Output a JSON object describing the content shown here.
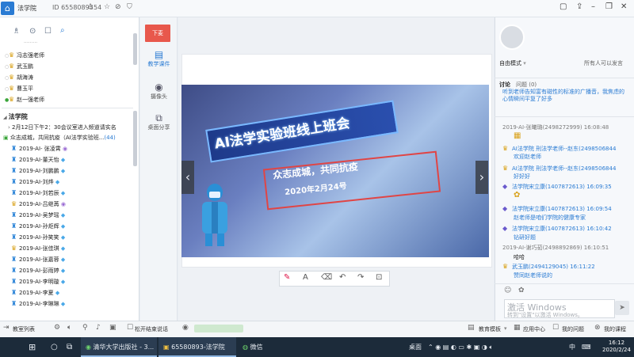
{
  "titlebar": {
    "app_name": "法学院",
    "room_id": "ID 65580893",
    "online_count": "54",
    "icons": [
      "home-icon",
      "user-count-icon",
      "bookmark-icon",
      "no-audio-icon",
      "shield-icon"
    ]
  },
  "left_panel": {
    "tool_icons": [
      "member-list-icon",
      "location-icon",
      "note-icon",
      "search-icon"
    ],
    "top_members": [
      {
        "name": "冯志强老师",
        "hat": "gold"
      },
      {
        "name": "武玉鹏",
        "hat": "gold"
      },
      {
        "name": "胡海涛",
        "hat": "gold"
      },
      {
        "name": "曹玉平",
        "hat": "gold"
      },
      {
        "name": "赵一强老师",
        "hat": "gold",
        "online": true
      }
    ],
    "section_title": "法学院",
    "notice": "2月12日下午2：30会议室进入频道请实名",
    "group_name": "众志成城，共同抗疫（AI法学实验班...",
    "group_count": "(44)",
    "members": [
      "2019-AI- 张凌霄",
      "2019-AI-董天怡",
      "2019-AI-刘鹏鹏",
      "2019-AI-刘烨",
      "2019-AI-刘若辰",
      "2019-AI-吕继苒",
      "2019-AI-吴梦瑶",
      "2019-AI-孙炬辉",
      "2019-AI-孙笑笑",
      "2019-AI-张佳琪",
      "2019-AI-张嘉蓉",
      "2019-AI-彭雨婷",
      "2019-AI-李明璇",
      "2019-AI-李夏",
      "2019-AI-李琳琳"
    ]
  },
  "mid_toolbar": {
    "raise_hand": "下麦",
    "items": [
      {
        "label": "教学课件",
        "icon": "courseware-icon",
        "active": true
      },
      {
        "label": "摄像头",
        "icon": "camera-icon",
        "active": false
      },
      {
        "label": "桌面分享",
        "icon": "screen-share-icon",
        "active": false
      }
    ]
  },
  "slide": {
    "title": "AI法学实验班线上班会",
    "motto": "众志成城，共同抗疫",
    "date": "2020年2月24号"
  },
  "draw_tools": [
    "pen-icon",
    "text-icon",
    "eraser-icon",
    "undo-icon",
    "redo-icon",
    "lock-icon"
  ],
  "right_panel": {
    "mode": "自由模式",
    "speak_perm": "所有人可以发言",
    "tabs": [
      "讨论",
      "问题 (0)"
    ],
    "question_text": "听到老师告知富有磁性的标准的广播音，我焦虑的心情瞬间平复了好多",
    "messages": [
      {
        "name": "2019-AI-张曦璐(2498272999) 16:08:48",
        "text": "",
        "style": "grey",
        "icon": "bread-icon"
      },
      {
        "name": "AI法学院 刑法学老师--赵东(2498506844",
        "text": "欢迎赵老师",
        "style": "blue",
        "icon": "badge-icon"
      },
      {
        "name": "AI法学院 刑法学老师--赵东(2498506844",
        "text": "好好好",
        "style": "blue",
        "icon": "badge-icon"
      },
      {
        "name": "法学院宋立康(1407872613) 16:09:35",
        "text": "",
        "style": "blue",
        "icon": "gem-icon"
      },
      {
        "name": "法学院宋立康(1407872613) 16:09:54",
        "text": "赵老师是咱们学院的健康专家",
        "style": "blue",
        "icon": "gem-icon"
      },
      {
        "name": "法学院宋立康(1407872613) 16:10:42",
        "text": "钻研好题",
        "style": "blue",
        "icon": "gem-icon"
      },
      {
        "name": "2019-AI-谢巧茹(2498892869) 16:10:51",
        "text": "哈哈",
        "style": "grey",
        "icon": ""
      },
      {
        "name": "武玉鹏(2494129045) 16:11:22",
        "text": "赞同赵老师说的",
        "style": "blue",
        "icon": "badge-icon"
      }
    ],
    "activate_title": "激活 Windows",
    "activate_sub": "转到\"设置\"以激活 Windows。"
  },
  "statusbar": {
    "left": "教室列表",
    "hint": "松开结束说话",
    "right_items": [
      "教育模板",
      "应用中心",
      "我的问题",
      "我的课程"
    ]
  },
  "taskbar": {
    "apps": [
      "清华大学出版社 - 3...",
      "65580893-法学院",
      "微信"
    ],
    "desktop": "桌面",
    "ime": "中",
    "time": "16:12",
    "date": "2020/2/24"
  },
  "colors": {
    "accent": "#2a7bd3",
    "raise_hand": "#e8584c",
    "taskbar": "#1c2b3a"
  }
}
